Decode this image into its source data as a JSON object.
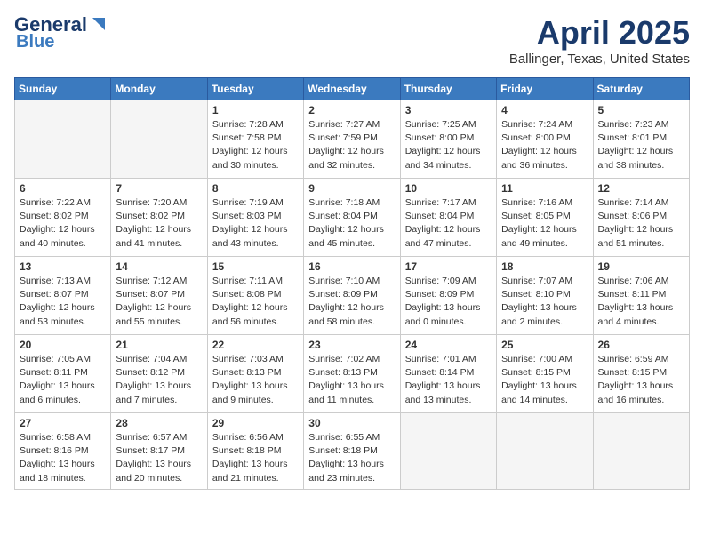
{
  "header": {
    "logo_line1": "General",
    "logo_line2": "Blue",
    "month_title": "April 2025",
    "location": "Ballinger, Texas, United States"
  },
  "weekdays": [
    "Sunday",
    "Monday",
    "Tuesday",
    "Wednesday",
    "Thursday",
    "Friday",
    "Saturday"
  ],
  "weeks": [
    [
      {
        "day": "",
        "detail": ""
      },
      {
        "day": "",
        "detail": ""
      },
      {
        "day": "1",
        "detail": "Sunrise: 7:28 AM\nSunset: 7:58 PM\nDaylight: 12 hours and 30 minutes."
      },
      {
        "day": "2",
        "detail": "Sunrise: 7:27 AM\nSunset: 7:59 PM\nDaylight: 12 hours and 32 minutes."
      },
      {
        "day": "3",
        "detail": "Sunrise: 7:25 AM\nSunset: 8:00 PM\nDaylight: 12 hours and 34 minutes."
      },
      {
        "day": "4",
        "detail": "Sunrise: 7:24 AM\nSunset: 8:00 PM\nDaylight: 12 hours and 36 minutes."
      },
      {
        "day": "5",
        "detail": "Sunrise: 7:23 AM\nSunset: 8:01 PM\nDaylight: 12 hours and 38 minutes."
      }
    ],
    [
      {
        "day": "6",
        "detail": "Sunrise: 7:22 AM\nSunset: 8:02 PM\nDaylight: 12 hours and 40 minutes."
      },
      {
        "day": "7",
        "detail": "Sunrise: 7:20 AM\nSunset: 8:02 PM\nDaylight: 12 hours and 41 minutes."
      },
      {
        "day": "8",
        "detail": "Sunrise: 7:19 AM\nSunset: 8:03 PM\nDaylight: 12 hours and 43 minutes."
      },
      {
        "day": "9",
        "detail": "Sunrise: 7:18 AM\nSunset: 8:04 PM\nDaylight: 12 hours and 45 minutes."
      },
      {
        "day": "10",
        "detail": "Sunrise: 7:17 AM\nSunset: 8:04 PM\nDaylight: 12 hours and 47 minutes."
      },
      {
        "day": "11",
        "detail": "Sunrise: 7:16 AM\nSunset: 8:05 PM\nDaylight: 12 hours and 49 minutes."
      },
      {
        "day": "12",
        "detail": "Sunrise: 7:14 AM\nSunset: 8:06 PM\nDaylight: 12 hours and 51 minutes."
      }
    ],
    [
      {
        "day": "13",
        "detail": "Sunrise: 7:13 AM\nSunset: 8:07 PM\nDaylight: 12 hours and 53 minutes."
      },
      {
        "day": "14",
        "detail": "Sunrise: 7:12 AM\nSunset: 8:07 PM\nDaylight: 12 hours and 55 minutes."
      },
      {
        "day": "15",
        "detail": "Sunrise: 7:11 AM\nSunset: 8:08 PM\nDaylight: 12 hours and 56 minutes."
      },
      {
        "day": "16",
        "detail": "Sunrise: 7:10 AM\nSunset: 8:09 PM\nDaylight: 12 hours and 58 minutes."
      },
      {
        "day": "17",
        "detail": "Sunrise: 7:09 AM\nSunset: 8:09 PM\nDaylight: 13 hours and 0 minutes."
      },
      {
        "day": "18",
        "detail": "Sunrise: 7:07 AM\nSunset: 8:10 PM\nDaylight: 13 hours and 2 minutes."
      },
      {
        "day": "19",
        "detail": "Sunrise: 7:06 AM\nSunset: 8:11 PM\nDaylight: 13 hours and 4 minutes."
      }
    ],
    [
      {
        "day": "20",
        "detail": "Sunrise: 7:05 AM\nSunset: 8:11 PM\nDaylight: 13 hours and 6 minutes."
      },
      {
        "day": "21",
        "detail": "Sunrise: 7:04 AM\nSunset: 8:12 PM\nDaylight: 13 hours and 7 minutes."
      },
      {
        "day": "22",
        "detail": "Sunrise: 7:03 AM\nSunset: 8:13 PM\nDaylight: 13 hours and 9 minutes."
      },
      {
        "day": "23",
        "detail": "Sunrise: 7:02 AM\nSunset: 8:13 PM\nDaylight: 13 hours and 11 minutes."
      },
      {
        "day": "24",
        "detail": "Sunrise: 7:01 AM\nSunset: 8:14 PM\nDaylight: 13 hours and 13 minutes."
      },
      {
        "day": "25",
        "detail": "Sunrise: 7:00 AM\nSunset: 8:15 PM\nDaylight: 13 hours and 14 minutes."
      },
      {
        "day": "26",
        "detail": "Sunrise: 6:59 AM\nSunset: 8:15 PM\nDaylight: 13 hours and 16 minutes."
      }
    ],
    [
      {
        "day": "27",
        "detail": "Sunrise: 6:58 AM\nSunset: 8:16 PM\nDaylight: 13 hours and 18 minutes."
      },
      {
        "day": "28",
        "detail": "Sunrise: 6:57 AM\nSunset: 8:17 PM\nDaylight: 13 hours and 20 minutes."
      },
      {
        "day": "29",
        "detail": "Sunrise: 6:56 AM\nSunset: 8:18 PM\nDaylight: 13 hours and 21 minutes."
      },
      {
        "day": "30",
        "detail": "Sunrise: 6:55 AM\nSunset: 8:18 PM\nDaylight: 13 hours and 23 minutes."
      },
      {
        "day": "",
        "detail": ""
      },
      {
        "day": "",
        "detail": ""
      },
      {
        "day": "",
        "detail": ""
      }
    ]
  ]
}
